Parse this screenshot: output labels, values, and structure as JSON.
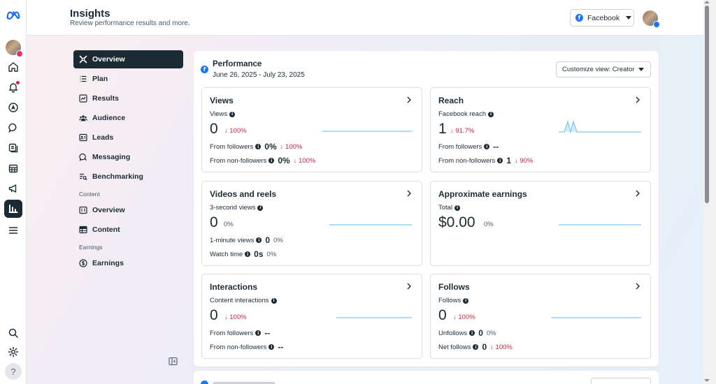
{
  "header": {
    "title": "Insights",
    "subtitle": "Review performance results and more.",
    "platform_selector": "Facebook"
  },
  "rail": {
    "icons": [
      "meta-logo-icon",
      "profile-avatar",
      "home-icon",
      "notifications-icon",
      "create-icon",
      "messages-icon",
      "content-icon",
      "calendar-icon",
      "ads-icon",
      "insights-icon",
      "menu-icon",
      "search-icon",
      "settings-icon",
      "help-icon"
    ],
    "help_label": "?"
  },
  "nav": {
    "items": [
      {
        "label": "Overview",
        "icon": "overview-icon",
        "active": true
      },
      {
        "label": "Plan",
        "icon": "plan-icon"
      },
      {
        "label": "Results",
        "icon": "results-icon"
      },
      {
        "label": "Audience",
        "icon": "audience-icon"
      },
      {
        "label": "Leads",
        "icon": "leads-icon"
      },
      {
        "label": "Messaging",
        "icon": "messaging-icon"
      },
      {
        "label": "Benchmarking",
        "icon": "benchmarking-icon"
      }
    ],
    "content_section": "Content",
    "content_items": [
      {
        "label": "Overview",
        "icon": "content-overview-icon"
      },
      {
        "label": "Content",
        "icon": "content-table-icon"
      }
    ],
    "earnings_section": "Earnings",
    "earnings_items": [
      {
        "label": "Earnings",
        "icon": "earnings-icon"
      }
    ]
  },
  "performance": {
    "title": "Performance",
    "date_range": "June 26, 2025 - July 23, 2025",
    "customize_view": "Customize view: Creator",
    "cards": {
      "views": {
        "title": "Views",
        "metric_label": "Views",
        "value": "0",
        "change": "↓ 100%",
        "rows": [
          {
            "label": "From followers",
            "value": "0%",
            "change": "↓ 100%"
          },
          {
            "label": "From non-followers",
            "value": "0%",
            "change": "↓ 100%"
          }
        ]
      },
      "reach": {
        "title": "Reach",
        "metric_label": "Facebook reach",
        "value": "1",
        "change": "↓ 91.7%",
        "rows": [
          {
            "label": "From followers",
            "value": "--",
            "change": ""
          },
          {
            "label": "From non-followers",
            "value": "1",
            "change": "↓ 90%"
          }
        ]
      },
      "videos": {
        "title": "Videos and reels",
        "metric_label": "3-second views",
        "value": "0",
        "change": "0%",
        "rows": [
          {
            "label": "1-minute views",
            "value": "0",
            "change": "0%"
          },
          {
            "label": "Watch time",
            "value": "0s",
            "change": "0%"
          }
        ]
      },
      "earnings": {
        "title": "Approximate earnings",
        "metric_label": "Total",
        "value": "$0.00",
        "change": "0%"
      },
      "interactions": {
        "title": "Interactions",
        "metric_label": "Content interactions",
        "value": "0",
        "change": "↓ 100%",
        "rows": [
          {
            "label": "From followers",
            "value": "--",
            "change": ""
          },
          {
            "label": "From non-followers",
            "value": "--",
            "change": ""
          }
        ]
      },
      "follows": {
        "title": "Follows",
        "metric_label": "Follows",
        "value": "0",
        "change": "↓ 100%",
        "rows": [
          {
            "label": "Unfollows",
            "value": "0",
            "change": "0%"
          },
          {
            "label": "Net follows",
            "value": "0",
            "change": "↓ 100%"
          }
        ]
      }
    }
  },
  "colors": {
    "primary_dark": "#1c2b33",
    "facebook_blue": "#1877f2",
    "decrease_red": "#c02840",
    "sparkline": "#7fc8f0"
  }
}
